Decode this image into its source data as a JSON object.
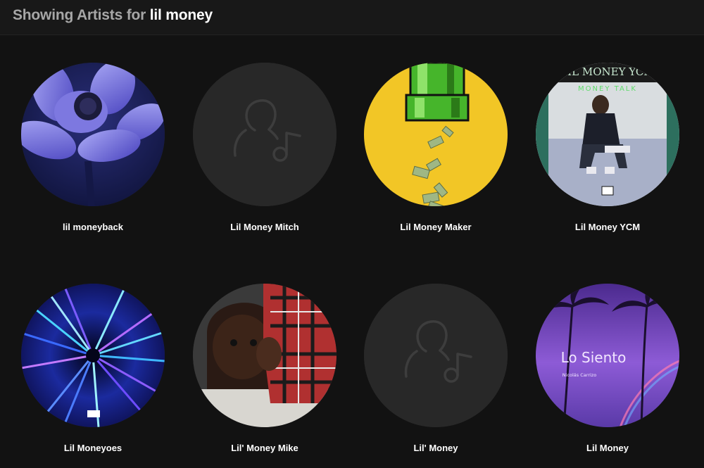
{
  "header": {
    "prefix": "Showing Artists for ",
    "query": "lil money"
  },
  "artists": [
    {
      "name": "lil moneyback",
      "image": "purple-flower"
    },
    {
      "name": "Lil Money Mitch",
      "image": "artist-placeholder-icon"
    },
    {
      "name": "Lil Money Maker",
      "image": "yellow-pipe-money"
    },
    {
      "name": "Lil Money YCM",
      "image": "seated-man-cover",
      "cover_text_top": "LIL MONEY YCM",
      "cover_text_sub": "MONEY TALK"
    },
    {
      "name": "Lil Moneyoes",
      "image": "hyperspace-tunnel"
    },
    {
      "name": "Lil' Money Mike",
      "image": "child-plaid-shirt"
    },
    {
      "name": "Lil' Money",
      "image": "artist-placeholder-icon"
    },
    {
      "name": "Lil Money",
      "image": "palm-trees-sunset",
      "cover_text_title": "Lo Siento",
      "cover_text_sub": "Nicolás Carrizo"
    }
  ]
}
